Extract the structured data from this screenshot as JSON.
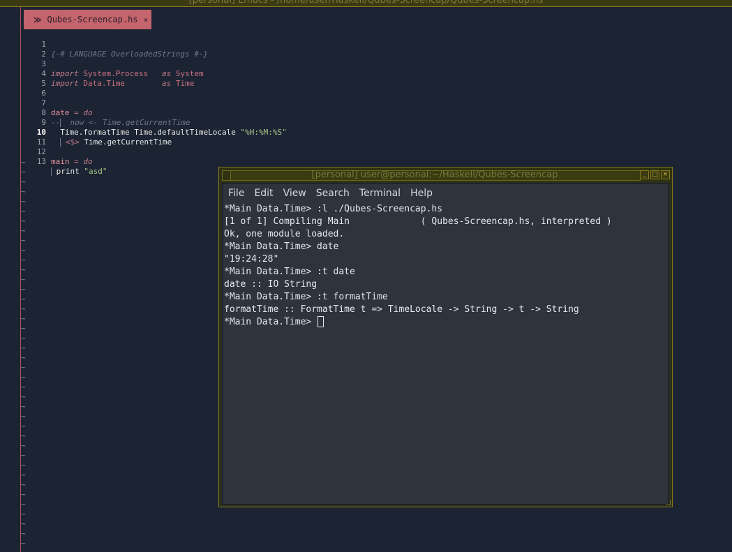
{
  "window": {
    "title": "[personal] Emacs - /home/user/Haskell/Qubes-Screencap/Qubes-Screencap.hs"
  },
  "tab": {
    "label": "Qubes-Screencap.hs",
    "close": "×",
    "icon": "haskell-icon"
  },
  "editor": {
    "lines": [
      {
        "n": "1",
        "text": "{-# LANGUAGE OverloadedStrings #-}"
      },
      {
        "n": "2",
        "text": ""
      },
      {
        "n": "3",
        "text": "import System.Process   as System"
      },
      {
        "n": "4",
        "text": "import Data.Time        as Time"
      },
      {
        "n": "5",
        "text": ""
      },
      {
        "n": "6",
        "text": ""
      },
      {
        "n": "7",
        "text": "date = do"
      },
      {
        "n": "8",
        "text": "--  now <- Time.getCurrentTime"
      },
      {
        "n": "9",
        "text": "  Time.formatTime Time.defaultTimeLocale \"%H:%M:%S\""
      },
      {
        "n": "10",
        "text": "    <$> Time.getCurrentTime"
      },
      {
        "n": "11",
        "text": ""
      },
      {
        "n": "12",
        "text": "main = do"
      },
      {
        "n": "13",
        "text": "  print \"asd\""
      }
    ],
    "fringe_marker": "~"
  },
  "terminal": {
    "title": "[personal] user@personal:~/Haskell/Qubes-Screencap",
    "menu": [
      "File",
      "Edit",
      "View",
      "Search",
      "Terminal",
      "Help"
    ],
    "lines": [
      "*Main Data.Time> :l ./Qubes-Screencap.hs",
      "[1 of 1] Compiling Main             ( Qubes-Screencap.hs, interpreted )",
      "Ok, one module loaded.",
      "*Main Data.Time> date",
      "\"19:24:28\"",
      "*Main Data.Time> :t date",
      "date :: IO String",
      "*Main Data.Time> :t formatTime",
      "formatTime :: FormatTime t => TimeLocale -> String -> t -> String"
    ],
    "prompt": "*Main Data.Time> ",
    "buttons": {
      "minimize": "_",
      "maximize": "□",
      "close": "×"
    }
  },
  "colors": {
    "background": "#1c2433",
    "tab": "#c4646d",
    "terminal_bg": "#2e333c",
    "frame": "#8a7a1a"
  }
}
